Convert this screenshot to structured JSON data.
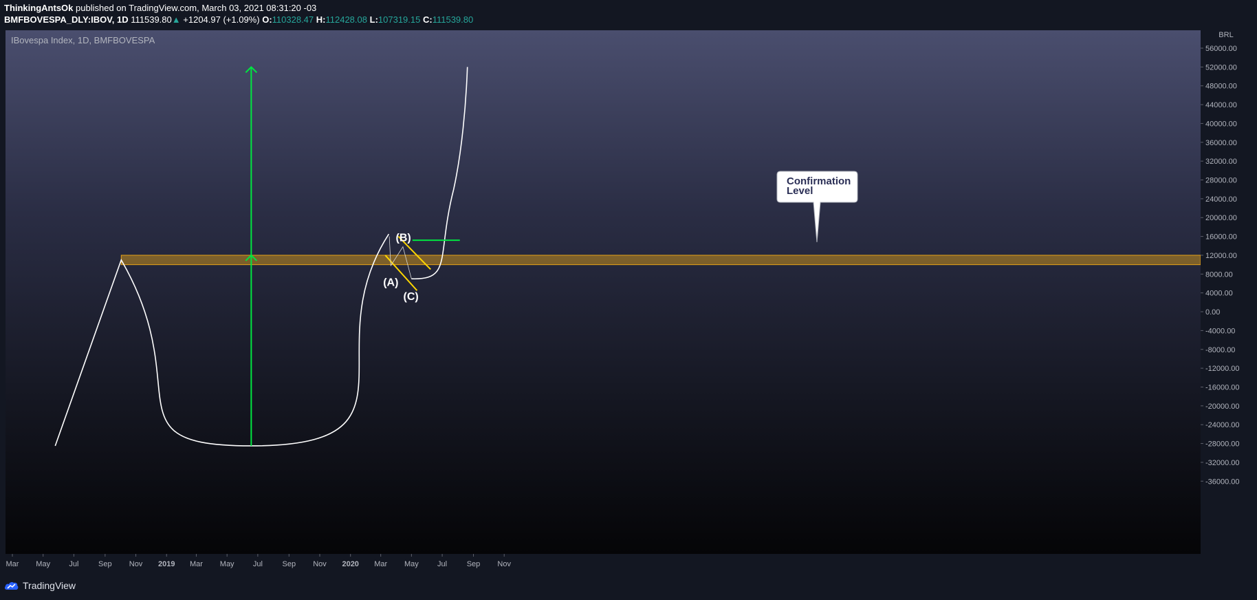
{
  "header": {
    "author": "ThinkingAntsOk",
    "published_text": "published on TradingView.com, March 03, 2021 08:31:20 -03",
    "symbol": "BMFBOVESPA_DLY:IBOV, 1D",
    "price": "111539.80",
    "change": "+1204.97 (+1.09%)",
    "o_label": "O:",
    "o_value": "110328.47",
    "h_label": "H:",
    "h_value": "112428.08",
    "l_label": "L:",
    "l_value": "107319.15",
    "c_label": "C:",
    "c_value": "111539.80"
  },
  "chart": {
    "symbol_label": "IBovespa Index, 1D, BMFBOVESPA",
    "currency": "BRL"
  },
  "footer": {
    "brand": "TradingView"
  },
  "chart_data": {
    "type": "line",
    "title": "IBovespa Index, 1D, BMFBOVESPA",
    "y_axis_ticks": [
      "56000.00",
      "52000.00",
      "48000.00",
      "44000.00",
      "40000.00",
      "36000.00",
      "32000.00",
      "28000.00",
      "24000.00",
      "20000.00",
      "16000.00",
      "12000.00",
      "8000.00",
      "4000.00",
      "0.00",
      "-4000.00",
      "-8000.00",
      "-12000.00",
      "-16000.00",
      "-20000.00",
      "-24000.00",
      "-28000.00",
      "-32000.00",
      "-36000.00"
    ],
    "x_axis_ticks": [
      "Mar",
      "May",
      "Jul",
      "Sep",
      "Nov",
      "2019",
      "Mar",
      "May",
      "Jul",
      "Sep",
      "Nov",
      "2020",
      "Mar",
      "May",
      "Jul",
      "Sep",
      "Nov"
    ],
    "ylim": [
      -39000,
      57000
    ],
    "series": [
      {
        "kind": "drawn-path",
        "points": [
          {
            "x": "2018-05-25",
            "y": -28500
          },
          {
            "x": "2018-10-03",
            "y": 11000
          },
          {
            "x": "2019-06-18",
            "y": -28500
          },
          {
            "x": "2020-03-17",
            "y": 16500
          }
        ]
      },
      {
        "kind": "drawn-path",
        "points": [
          {
            "x": "2020-05-01",
            "y": 7000
          },
          {
            "x": "2020-06-15",
            "y": 9000
          },
          {
            "x": "2020-07-15",
            "y": 16000
          },
          {
            "x": "2020-08-20",
            "y": 52000
          }
        ]
      }
    ],
    "resistance_zone": {
      "y_low": 10000,
      "y_high": 12000,
      "x_start": "2018-10-03",
      "color": "#e8a317"
    },
    "target_arrow": {
      "x": "2019-06-18",
      "y_start": -28500,
      "y_end": 52000,
      "color": "#00e640"
    },
    "confirmation_line": {
      "y": 15200,
      "x_start": "2020-05-03",
      "x_end": "2020-08-05",
      "color": "#00e640"
    },
    "wave_labels": [
      {
        "text": "(A)",
        "x": "2020-03-21",
        "y": 5500
      },
      {
        "text": "(B)",
        "x": "2020-04-15",
        "y": 15000
      },
      {
        "text": "(C)",
        "x": "2020-04-30",
        "y": 2500
      }
    ],
    "callout": {
      "text": [
        "Confirmation",
        "Level"
      ]
    },
    "colors": {
      "price_path": "#ffffff",
      "channel": "#ffd700",
      "zone": "#e8a317",
      "arrow": "#00e640"
    }
  }
}
